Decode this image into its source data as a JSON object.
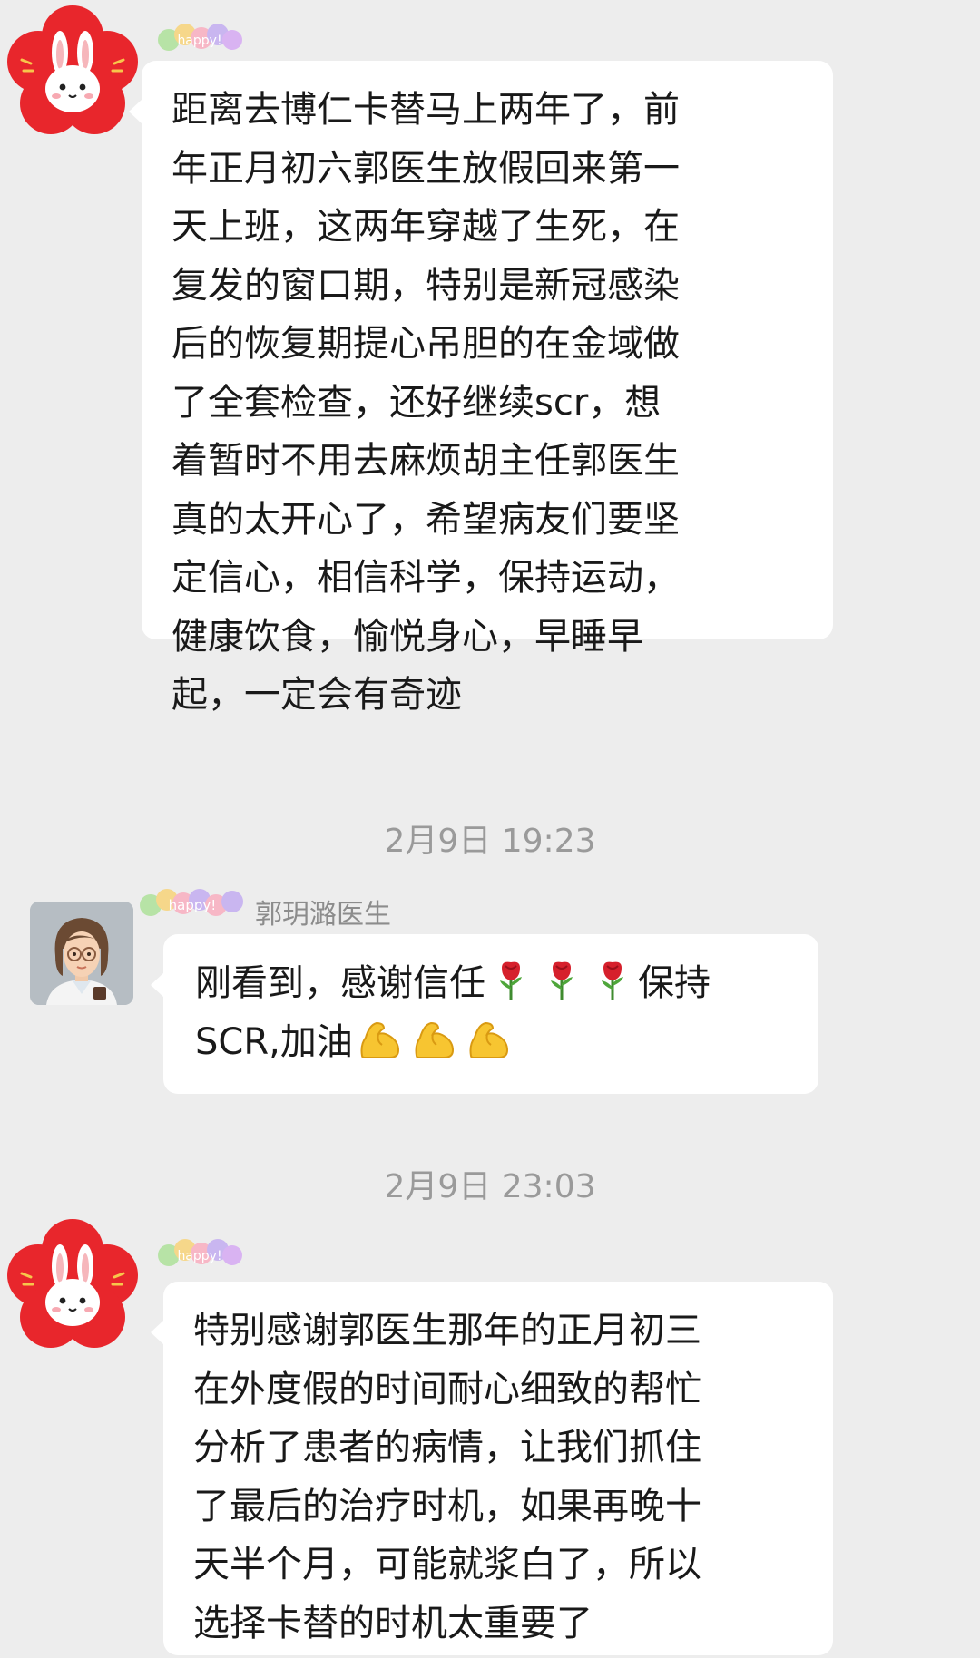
{
  "messages": [
    {
      "sender": "",
      "lines": [
        "距离去博仁卡替马上两年了，前",
        "年正月初六郭医生放假回来第一",
        "天上班，这两年穿越了生死，在",
        "复发的窗口期，特别是新冠感染",
        "后的恢复期提心吊胆的在金域做",
        "了全套检查，还好继续scr，想",
        "着暂时不用去麻烦胡主任郭医生",
        "真的太开心了，希望病友们要坚",
        "定信心，相信科学，保持运动，",
        "健康饮食，愉悦身心，早睡早",
        "起，一定会有奇迹"
      ]
    },
    {
      "sender": "郭玥潞医生",
      "line1_text": "刚看到，感谢信任",
      "line1_suffix": "保持",
      "line2_text": "SCR,加油",
      "emojis": [
        "rose-emoji",
        "rose-emoji",
        "rose-emoji",
        "flexed-biceps-emoji",
        "flexed-biceps-emoji",
        "flexed-biceps-emoji"
      ]
    },
    {
      "sender": "",
      "lines": [
        "特别感谢郭医生那年的正月初三",
        "在外度假的时间耐心细致的帮忙",
        "分析了患者的病情，让我们抓住",
        "了最后的治疗时机，如果再晚十",
        "天半个月，可能就浆白了，所以",
        "选择卡替的时机太重要了"
      ]
    }
  ],
  "timestamps": [
    "2月9日 19:23",
    "2月9日 23:03"
  ],
  "badge_text": "happy!",
  "colors": {
    "background": "#ededed",
    "bubble": "#ffffff",
    "text": "#191919",
    "timestamp": "#9a9a9a",
    "rabbit_avatar_red": "#e8262c"
  }
}
